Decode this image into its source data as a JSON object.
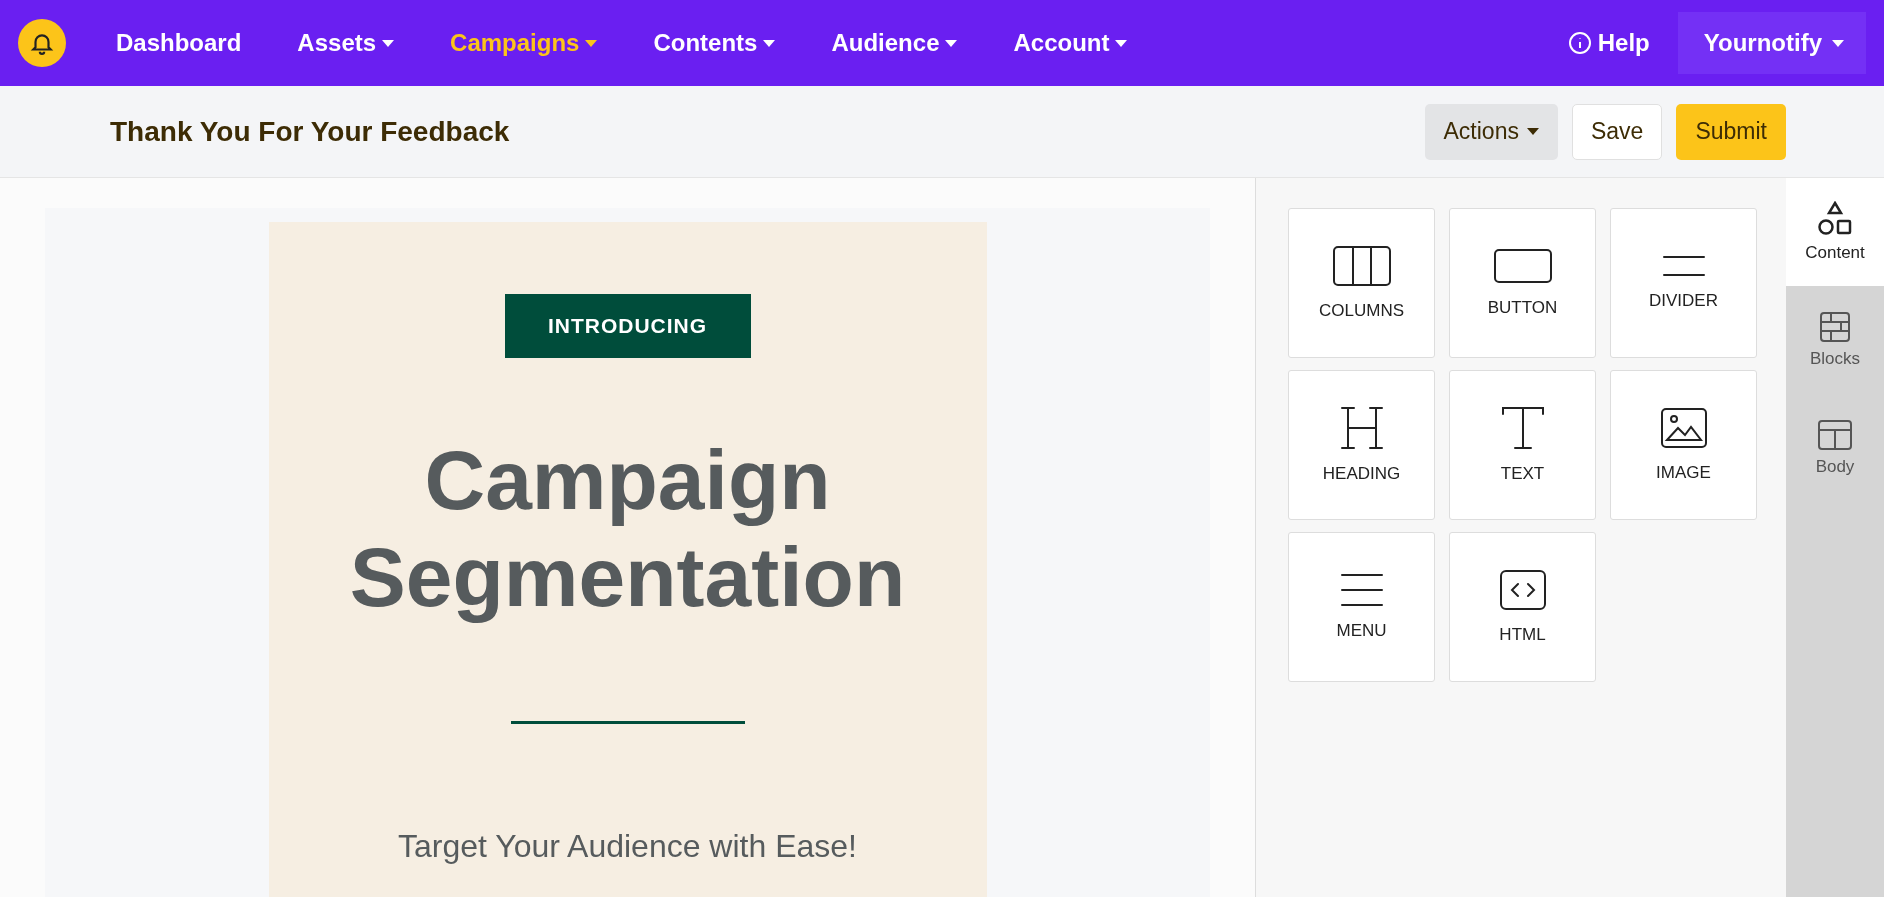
{
  "nav": {
    "items": [
      {
        "label": "Dashboard",
        "dropdown": false,
        "selected": false
      },
      {
        "label": "Assets",
        "dropdown": true,
        "selected": false
      },
      {
        "label": "Campaigns",
        "dropdown": true,
        "selected": true
      },
      {
        "label": "Contents",
        "dropdown": true,
        "selected": false
      },
      {
        "label": "Audience",
        "dropdown": true,
        "selected": false
      },
      {
        "label": "Account",
        "dropdown": true,
        "selected": false
      }
    ],
    "help": "Help",
    "account": "Yournotify"
  },
  "header": {
    "title": "Thank You For Your Feedback",
    "actions": "Actions",
    "save": "Save",
    "submit": "Submit"
  },
  "email": {
    "badge": "INTRODUCING",
    "headline": "Campaign Segmentation",
    "subtitle": "Target Your Audience with Ease!"
  },
  "tools": [
    {
      "kind": "columns",
      "label": "COLUMNS"
    },
    {
      "kind": "button",
      "label": "BUTTON"
    },
    {
      "kind": "divider",
      "label": "DIVIDER"
    },
    {
      "kind": "heading",
      "label": "HEADING"
    },
    {
      "kind": "text",
      "label": "TEXT"
    },
    {
      "kind": "image",
      "label": "IMAGE"
    },
    {
      "kind": "menu",
      "label": "MENU"
    },
    {
      "kind": "html",
      "label": "HTML"
    }
  ],
  "side_tabs": [
    {
      "kind": "content",
      "label": "Content",
      "selected": true
    },
    {
      "kind": "blocks",
      "label": "Blocks",
      "selected": false
    },
    {
      "kind": "body",
      "label": "Body",
      "selected": false
    }
  ]
}
